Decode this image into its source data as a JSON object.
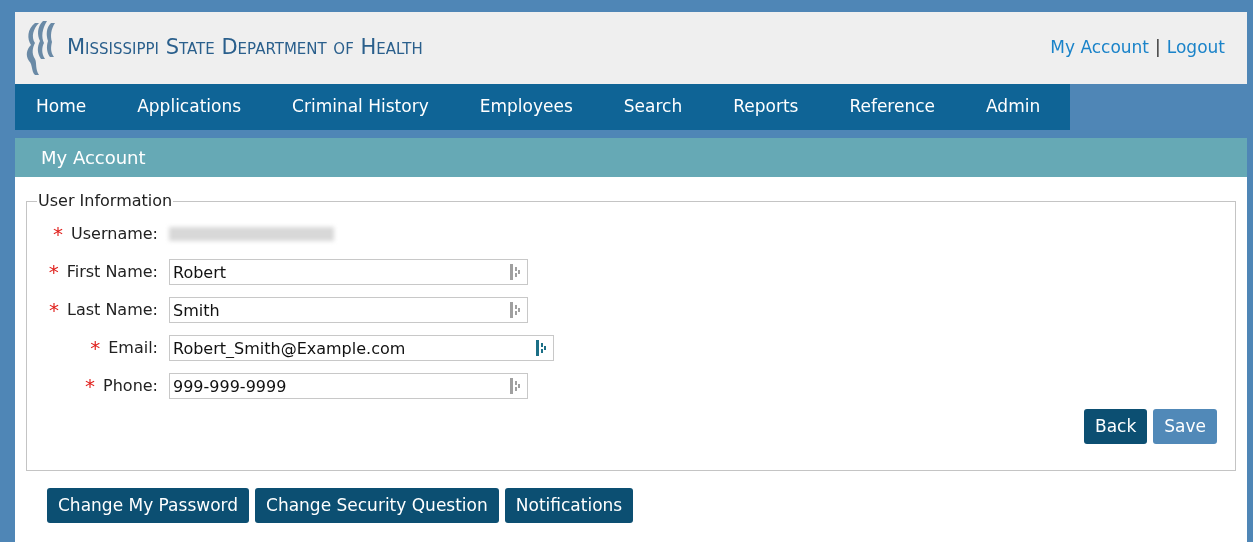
{
  "header": {
    "title": "Mississippi State Department of Health",
    "links": [
      {
        "label": "My Account"
      },
      {
        "label": "Logout"
      }
    ],
    "separator": "|"
  },
  "nav": {
    "items": [
      {
        "label": "Home"
      },
      {
        "label": "Applications"
      },
      {
        "label": "Criminal History"
      },
      {
        "label": "Employees"
      },
      {
        "label": "Search"
      },
      {
        "label": "Reports"
      },
      {
        "label": "Reference"
      },
      {
        "label": "Admin"
      }
    ]
  },
  "page_title": "My Account",
  "user_information": {
    "legend": "User Information",
    "required_mark": "*",
    "fields": [
      {
        "kind": "redacted",
        "label": "Username:"
      },
      {
        "kind": "input",
        "label": "First Name:",
        "value": "Robert",
        "wide": false,
        "active": false
      },
      {
        "kind": "input",
        "label": "Last Name:",
        "value": "Smith",
        "wide": false,
        "active": false
      },
      {
        "kind": "input",
        "label": "Email:",
        "value": "Robert_Smith@Example.com",
        "wide": true,
        "active": true
      },
      {
        "kind": "input",
        "label": "Phone:",
        "value": "999-999-9999",
        "wide": false,
        "active": false
      }
    ],
    "buttons": [
      {
        "label": "Back",
        "disabled": false
      },
      {
        "label": "Save",
        "disabled": true
      }
    ]
  },
  "bottom_buttons": [
    {
      "label": "Change My Password"
    },
    {
      "label": "Change Security Question"
    },
    {
      "label": "Notifications"
    }
  ]
}
